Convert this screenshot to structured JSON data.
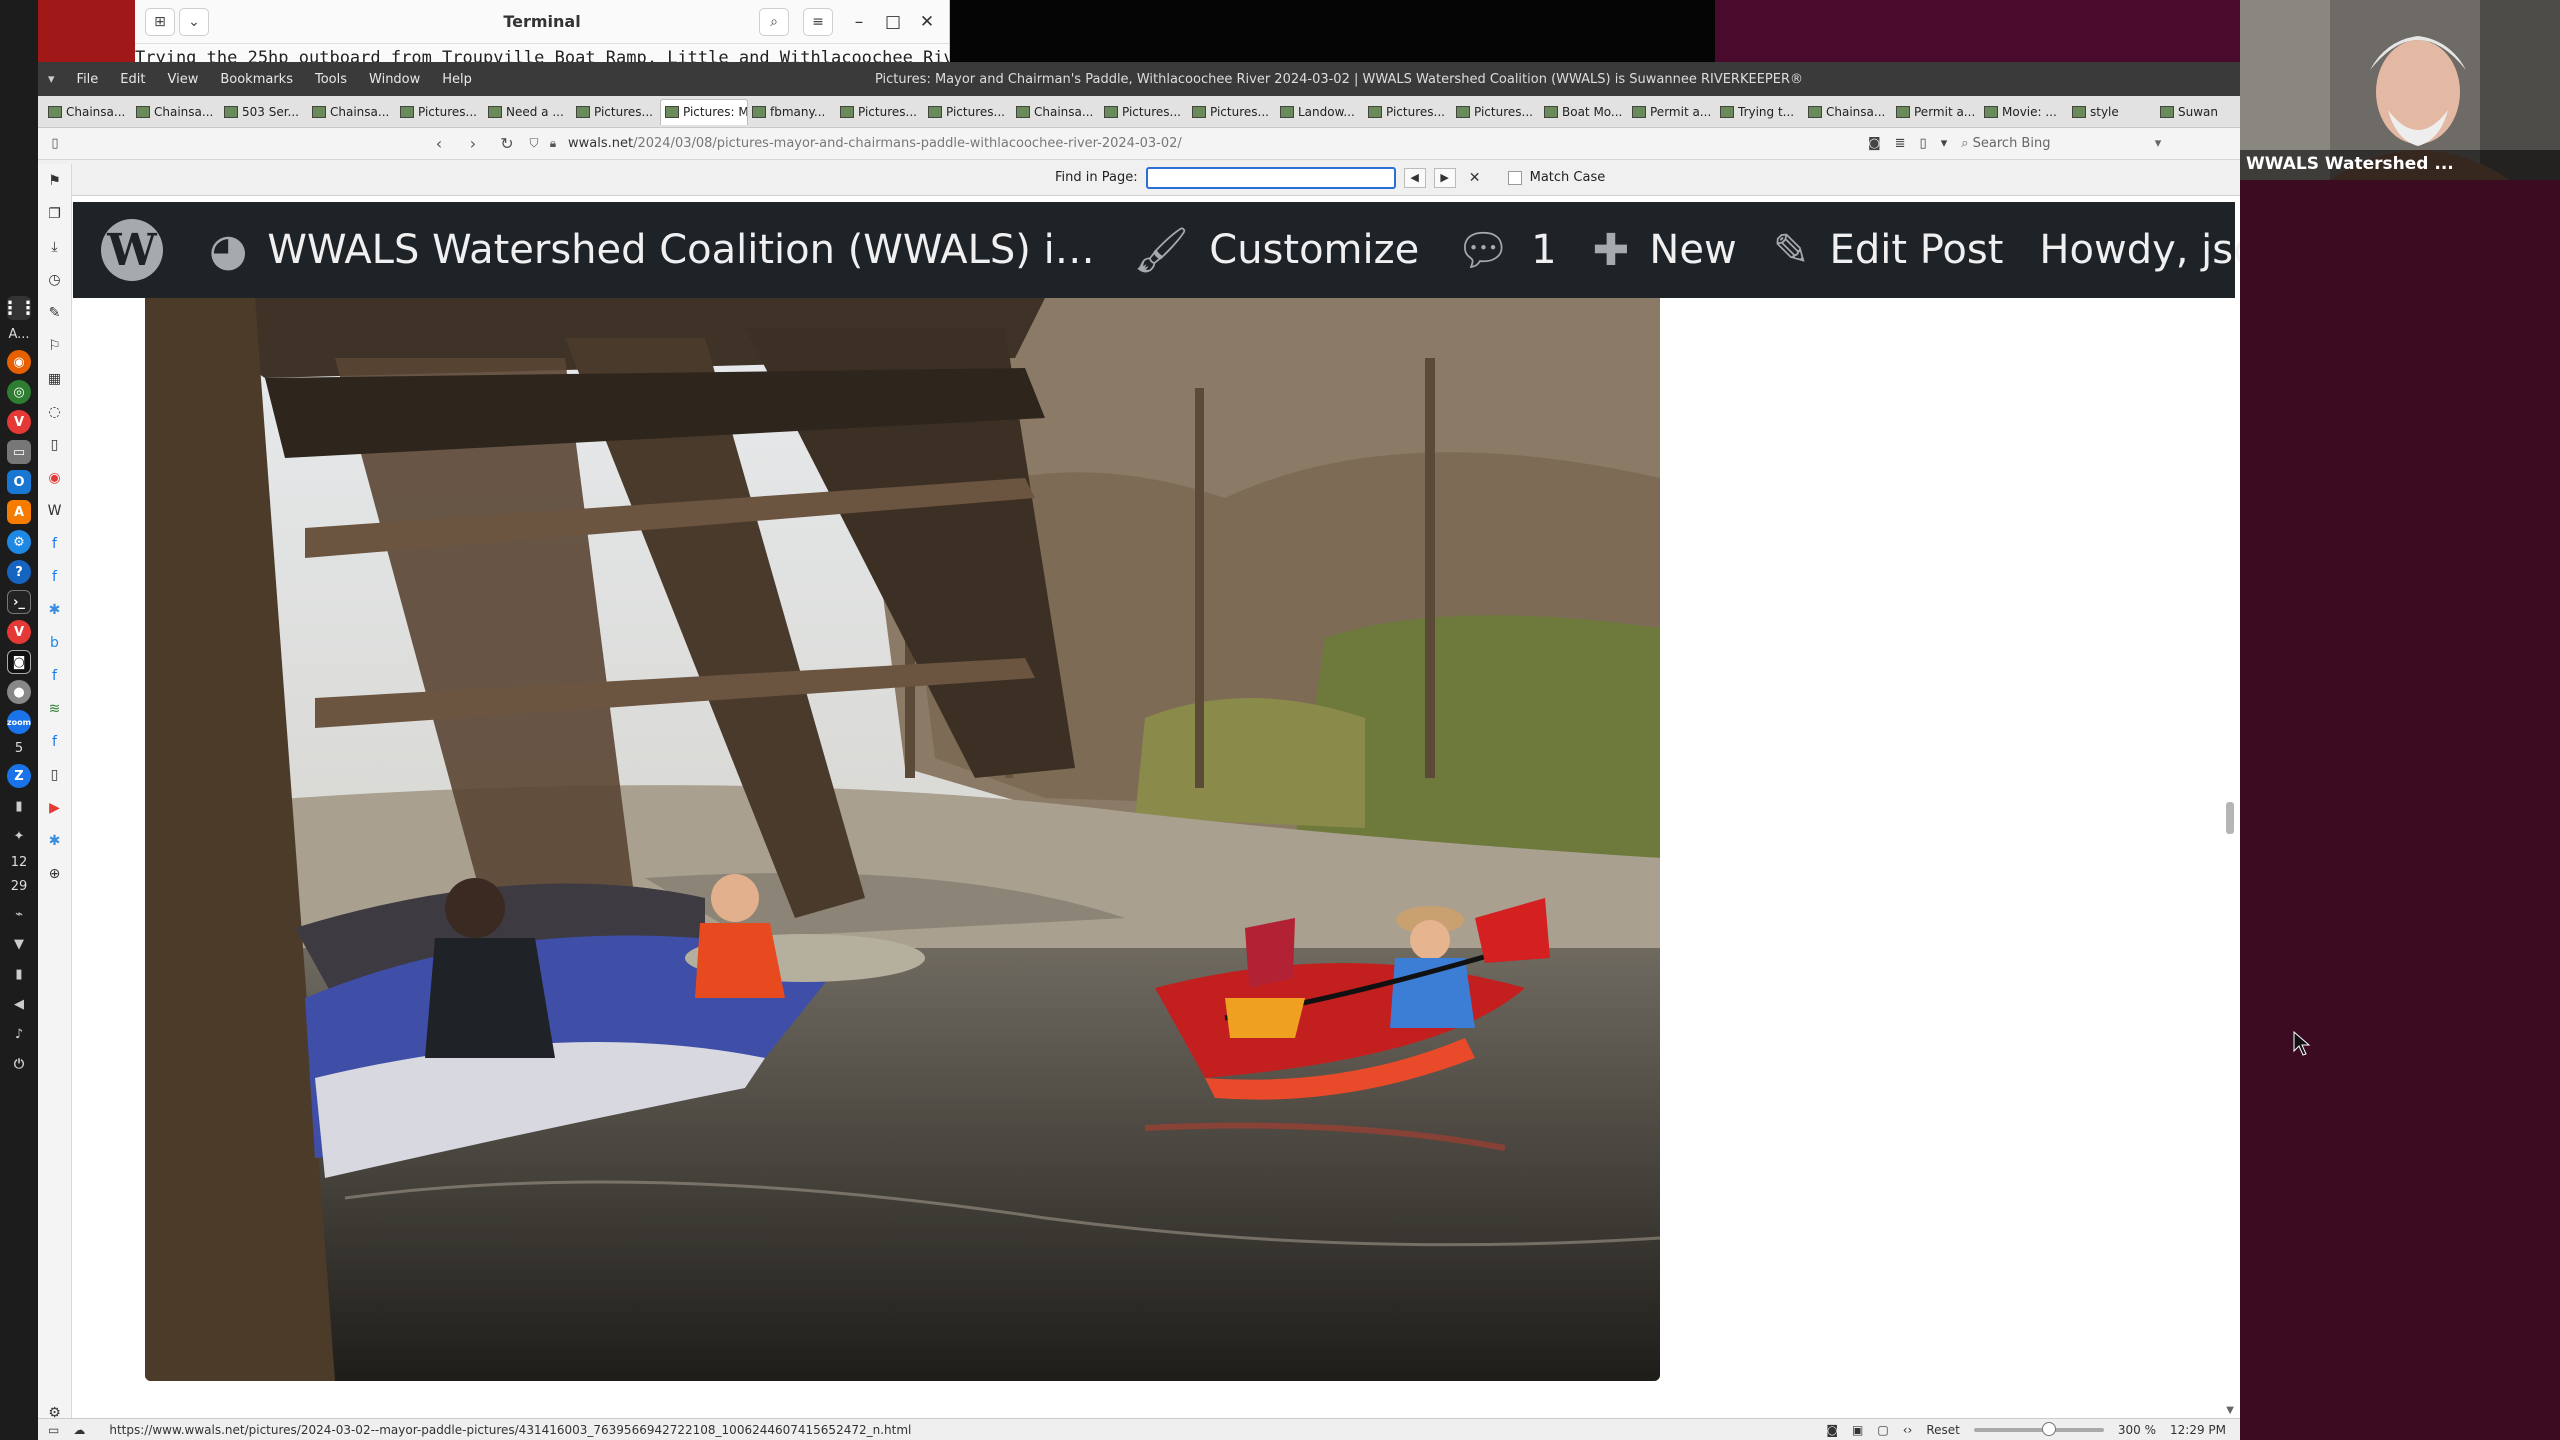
{
  "terminal": {
    "title": "Terminal",
    "line": "Trying the 25hp outboard from Troupville Boat Ramp, Little and Withlacoochee Riv"
  },
  "browser": {
    "menu": [
      "File",
      "Edit",
      "View",
      "Bookmarks",
      "Tools",
      "Window",
      "Help"
    ],
    "window_title": "Pictures: Mayor and Chairman's Paddle, Withlacoochee River 2024-03-02 | WWALS Watershed Coalition (WWALS) is Suwannee RIVERKEEPER®",
    "tabs": [
      "Chainsa...",
      "Chainsa...",
      "503 Ser...",
      "Chainsa...",
      "Pictures...",
      "Need a ...",
      "Pictures...",
      "Pictures: M",
      "fbmany...",
      "Pictures...",
      "Pictures...",
      "Chainsa...",
      "Pictures...",
      "Pictures...",
      "Landow...",
      "Pictures...",
      "Pictures...",
      "Boat Mo...",
      "Permit a...",
      "Trying t...",
      "Chainsa...",
      "Permit a...",
      "Movie: ...",
      "style",
      "Suwan"
    ],
    "active_tab_index": 7,
    "url_host": "wwals.net",
    "url_path": "/2024/03/08/pictures-mayor-and-chairmans-paddle-withlacoochee-river-2024-03-02/",
    "search_placeholder": "Search Bing",
    "find": {
      "label": "Find in Page:",
      "value": "",
      "match_case": "Match Case"
    },
    "status_url": "https://www.wwals.net/pictures/2024-03-02--mayor-paddle-pictures/431416003_763956694272210​8_1006244607415652472_n.html",
    "reset_label": "Reset",
    "zoom_level": "300 %",
    "clock": "12:29 PM"
  },
  "adminbar": {
    "site_name": "WWALS Watershed Coalition (WWALS) is Suw...",
    "customize": "Customize",
    "comments_count": "1",
    "new_label": "New",
    "edit_post": "Edit Post",
    "howdy": "Howdy, jsq"
  },
  "dock": {
    "label_a": "A...",
    "label_5": "5",
    "label_12": "12",
    "label_29": "29"
  },
  "zoom": {
    "name": "WWALS Watershed ..."
  },
  "colors": {
    "admin_bar": "#1d2327",
    "admin_icon": "#a7aaad",
    "find_focus": "#2a6fd6"
  }
}
